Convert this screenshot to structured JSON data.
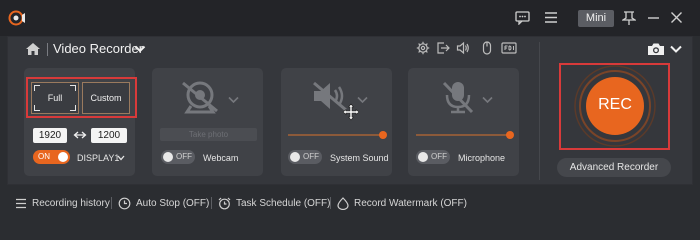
{
  "window": {
    "mini_label": "Mini"
  },
  "header": {
    "module_title": "Video Recorder"
  },
  "display_card": {
    "full_label": "Full",
    "custom_label": "Custom",
    "width": "1920",
    "height": "1200",
    "toggle_label": "ON",
    "display_name": "DISPLAY1"
  },
  "webcam_card": {
    "take_photo_label": "Take photo",
    "toggle_label": "OFF",
    "label": "Webcam"
  },
  "sound_card": {
    "toggle_label": "OFF",
    "label": "System Sound",
    "volume": 1.0
  },
  "mic_card": {
    "toggle_label": "OFF",
    "label": "Microphone",
    "volume": 1.0
  },
  "rec": {
    "label": "REC",
    "advanced_label": "Advanced Recorder"
  },
  "footer": {
    "history": "Recording history",
    "auto_stop": "Auto Stop (OFF)",
    "task_schedule": "Task Schedule (OFF)",
    "watermark": "Record Watermark (OFF)"
  },
  "colors": {
    "accent": "#e8661f",
    "highlight": "#d83a3a",
    "background": "#2b2d31",
    "panel": "#35373c",
    "card": "#404247"
  }
}
